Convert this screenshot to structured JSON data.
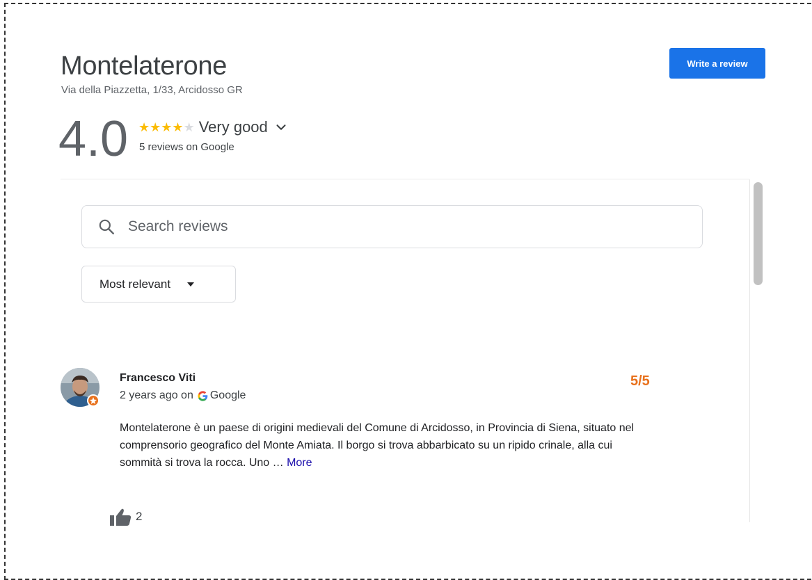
{
  "place": {
    "title": "Montelaterone",
    "address": "Via della Piazzetta, 1/33, Arcidosso GR"
  },
  "actions": {
    "write_review_label": "Write a review"
  },
  "summary": {
    "rating": "4.0",
    "stars_filled": 4,
    "stars_total": 5,
    "rating_text": "Very good",
    "reviews_count": "5 reviews on Google"
  },
  "search": {
    "placeholder": "Search reviews",
    "value": ""
  },
  "sort": {
    "selected": "Most relevant"
  },
  "reviews": [
    {
      "name": "Francesco Viti",
      "time": "2 years ago on",
      "source": "Google",
      "score": "5/5",
      "text": "Montelaterone è un paese di origini medievali del Comune di Arcidosso, in Provincia di Siena, situato nel comprensorio geografico del Monte Amiata. Il borgo si trova abbarbicato su un ripido crinale, alla cui sommità si trova la rocca. Uno …",
      "more_label": "More",
      "likes": "2"
    }
  ],
  "icons": {
    "search": "search-icon",
    "chevron": "chevron-down-icon",
    "sort_caret": "caret-down-icon",
    "google": "google-g-icon",
    "thumb": "thumbs-up-icon",
    "avatar_badge": "local-guide-badge-icon"
  },
  "colors": {
    "accent": "#1a73e8",
    "star": "#fbbc04",
    "score": "#e8711c",
    "link": "#1a0dab"
  }
}
